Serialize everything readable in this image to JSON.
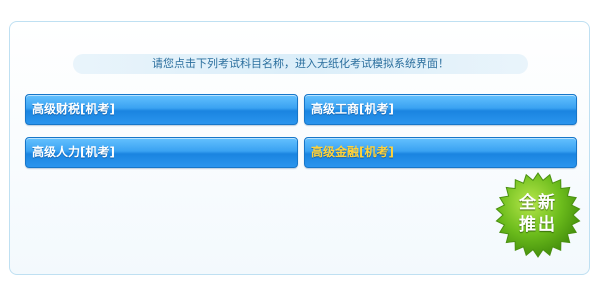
{
  "notice": {
    "text": "请您点击下列考试科目名称，进入无纸化考试模拟系统界面！"
  },
  "buttons": [
    {
      "label": "高级财税[机考]"
    },
    {
      "label": "高级工商[机考]"
    },
    {
      "label": "高级人力[机考]"
    },
    {
      "label": "高级金融[机考]"
    }
  ],
  "badge": {
    "line1": "全新",
    "line2": "推出"
  },
  "colors": {
    "button_blue": "#2a95ee",
    "highlight_text": "#ffd23a",
    "badge_green": "#5cab18",
    "notice_text": "#2b6f9e"
  }
}
